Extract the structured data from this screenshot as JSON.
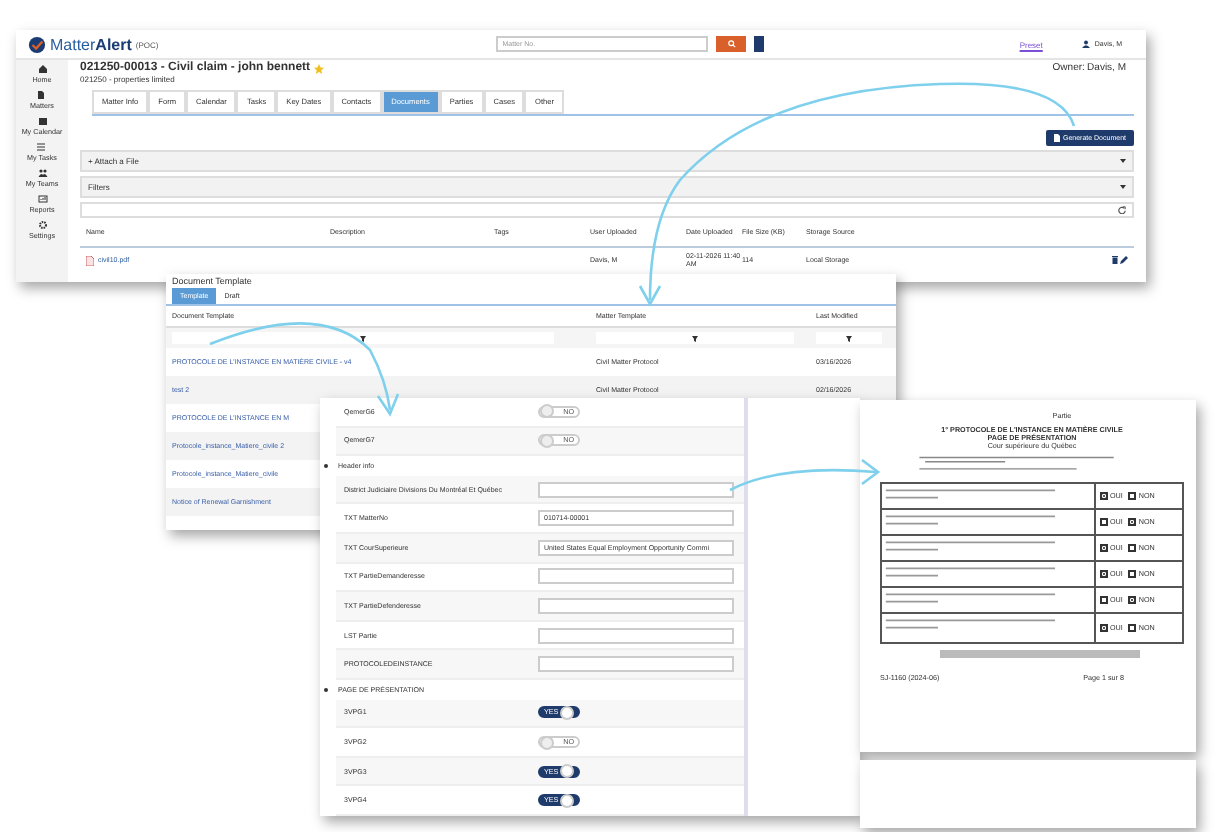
{
  "app_window": {
    "logo": "Matter",
    "logo_bold": "Alert",
    "logo_badge": "(POC)",
    "search": {
      "placeholder": "Matter No."
    },
    "preset_link": "Preset",
    "user": "Davis, M",
    "sidebar": [
      {
        "label": "Home"
      },
      {
        "label": "Matters"
      },
      {
        "label": "My Calendar"
      },
      {
        "label": "My Tasks"
      },
      {
        "label": "My Teams"
      },
      {
        "label": "Reports"
      },
      {
        "label": "Settings"
      }
    ],
    "matter_title": "021250-00013 - Civil claim - john bennett",
    "matter_subtitle": "021250 - properties limited",
    "owner_label": "Owner:",
    "owner": "Davis, M",
    "tabs": [
      {
        "label": "Matter Info",
        "selected": false
      },
      {
        "label": "Form",
        "selected": false
      },
      {
        "label": "Calendar",
        "selected": false
      },
      {
        "label": "Tasks",
        "selected": false
      },
      {
        "label": "Key Dates",
        "selected": false
      },
      {
        "label": "Contacts",
        "selected": false
      },
      {
        "label": "Documents",
        "selected": true
      },
      {
        "label": "Parties",
        "selected": false
      },
      {
        "label": "Cases",
        "selected": false
      },
      {
        "label": "Other",
        "selected": false
      }
    ],
    "generate_button": "Generate Document",
    "attach_bar": "+ Attach a File",
    "filters_bar": "Filters",
    "columns": [
      "Name",
      "Description",
      "Tags",
      "User Uploaded",
      "Date Uploaded",
      "File Size (KB)",
      "Storage Source"
    ],
    "rows": [
      {
        "name": "civil10.pdf",
        "description": "",
        "tags": "",
        "user": "Davis, M",
        "date": "02-11-2026 11:40 AM",
        "size": "114",
        "source": "Local Storage"
      }
    ]
  },
  "template_window": {
    "title": "Document Template",
    "tabs": [
      {
        "label": "Template",
        "selected": true
      },
      {
        "label": "Draft",
        "selected": false
      }
    ],
    "columns": [
      "Document Template",
      "Matter Template",
      "Last Modified"
    ],
    "rows": [
      {
        "name": "PROTOCOLE DE L'INSTANCE EN MATIÈRE CIVILE - v4",
        "matter_template": "Civil Matter Protocol",
        "last_modified": "03/16/2026"
      },
      {
        "name": "test 2",
        "matter_template": "Civil Matter Protocol",
        "last_modified": "02/16/2026"
      },
      {
        "name": "PROTOCOLE DE L'INSTANCE EN M"
      },
      {
        "name": "Protocole_instance_Matiere_civile 2"
      },
      {
        "name": "Protocole_instance_Matiere_civile"
      },
      {
        "name": "Notice of Renewal Garnishment"
      }
    ]
  },
  "form_window": {
    "rows": [
      {
        "kind": "toggle",
        "label": "QemerG6",
        "on": false,
        "toggle_text": "NO"
      },
      {
        "kind": "toggle",
        "label": "QemerG7",
        "on": false,
        "toggle_text": "NO"
      },
      {
        "kind": "section",
        "label": "Header info"
      },
      {
        "kind": "field",
        "label": "District Judiciaire Divisions Du Montréal Et Québec",
        "value": ""
      },
      {
        "kind": "field",
        "label": "TXT MatterNo",
        "value": "010714-00001"
      },
      {
        "kind": "field",
        "label": "TXT CourSuperieure",
        "value": "United States Equal Employment Opportunity Commi"
      },
      {
        "kind": "field",
        "label": "TXT PartieDemanderesse",
        "value": ""
      },
      {
        "kind": "field",
        "label": "TXT PartieDefenderesse",
        "value": ""
      },
      {
        "kind": "field",
        "label": "LST Partie",
        "value": ""
      },
      {
        "kind": "field",
        "label": "PROTOCOLEDEINSTANCE",
        "value": ""
      },
      {
        "kind": "section",
        "label": "PAGE DE PRÉSENTATION"
      },
      {
        "kind": "toggle",
        "label": "3VPG1",
        "on": true,
        "toggle_text": "YES"
      },
      {
        "kind": "toggle",
        "label": "3VPG2",
        "on": false,
        "toggle_text": "NO"
      },
      {
        "kind": "toggle",
        "label": "3VPG3",
        "on": true,
        "toggle_text": "YES"
      },
      {
        "kind": "toggle",
        "label": "3VPG4",
        "on": true,
        "toggle_text": "YES"
      }
    ]
  },
  "document_preview": {
    "party": "Partie",
    "heading": "1° PROTOCOLE DE L'INSTANCE EN MATIÈRE CIVILE",
    "subheading": "PAGE DE PRÉSENTATION",
    "court": "Cour supérieure du Québec",
    "answers": [
      {
        "oui": true,
        "oui_label": "OUI",
        "non": false,
        "non_label": "NON"
      },
      {
        "oui": false,
        "oui_label": "OUI",
        "non": true,
        "non_label": "NON"
      },
      {
        "oui": true,
        "oui_label": "OUI",
        "non": false,
        "non_label": "NON"
      },
      {
        "oui": true,
        "oui_label": "OUI",
        "non": false,
        "non_label": "NON"
      },
      {
        "oui": false,
        "oui_label": "OUI",
        "non": true,
        "non_label": "NON"
      },
      {
        "oui": true,
        "oui_label": "OUI",
        "non": false,
        "non_label": "NON"
      }
    ],
    "form_code": "SJ-1160 (2024-06)",
    "page": "Page 1 sur 8"
  }
}
